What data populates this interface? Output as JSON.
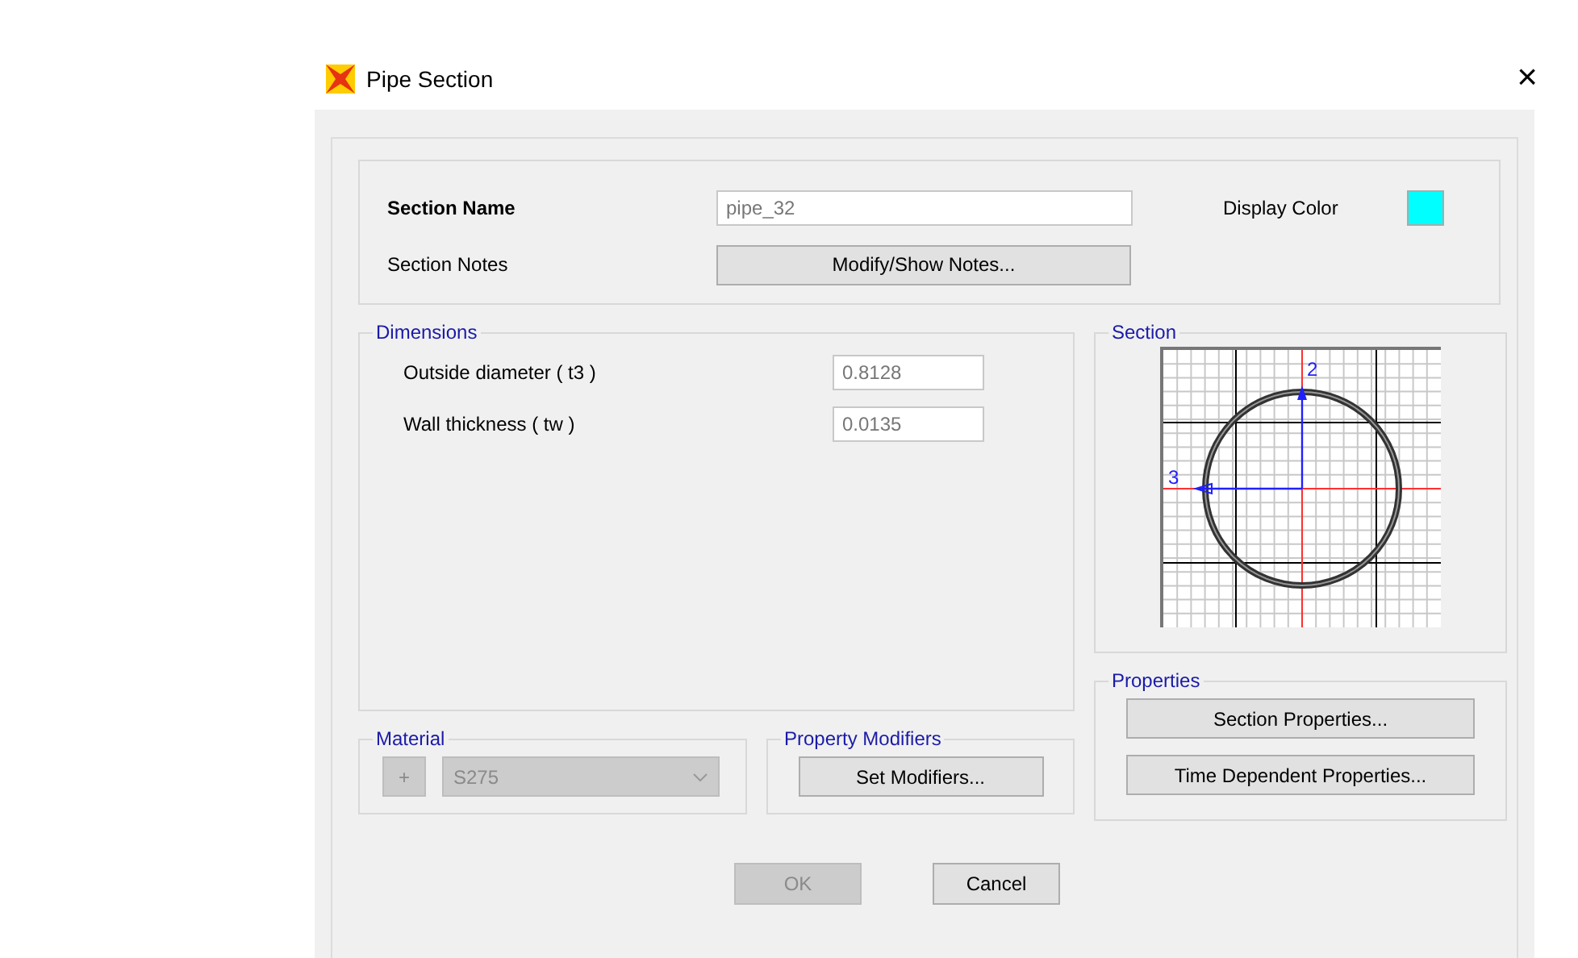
{
  "window": {
    "title": "Pipe Section",
    "close": "×"
  },
  "header": {
    "section_name_label": "Section Name",
    "section_name": "pipe_32",
    "display_color": {
      "label": "Display Color",
      "color": "#00ffff"
    },
    "section_notes_label": "Section Notes",
    "notes_button": "Modify/Show Notes..."
  },
  "dimensions": {
    "title": "Dimensions",
    "fields": [
      {
        "label": "Outside diameter  ( t3 )",
        "value": "0.8128"
      },
      {
        "label": "Wall thickness  ( tw )",
        "value": "0.0135"
      }
    ]
  },
  "section": {
    "title": "Section",
    "axis_vertical": "2",
    "axis_horizontal": "3"
  },
  "properties": {
    "title": "Properties",
    "buttons": [
      "Section Properties...",
      "Time Dependent Properties..."
    ]
  },
  "material": {
    "title": "Material",
    "add_button": "+",
    "value": "S275",
    "disabled": true
  },
  "property_modifiers": {
    "title": "Property Modifiers",
    "button": "Set Modifiers..."
  },
  "footer": {
    "buttons": [
      {
        "label": "OK",
        "disabled": true
      },
      {
        "label": "Cancel",
        "disabled": false
      }
    ]
  }
}
